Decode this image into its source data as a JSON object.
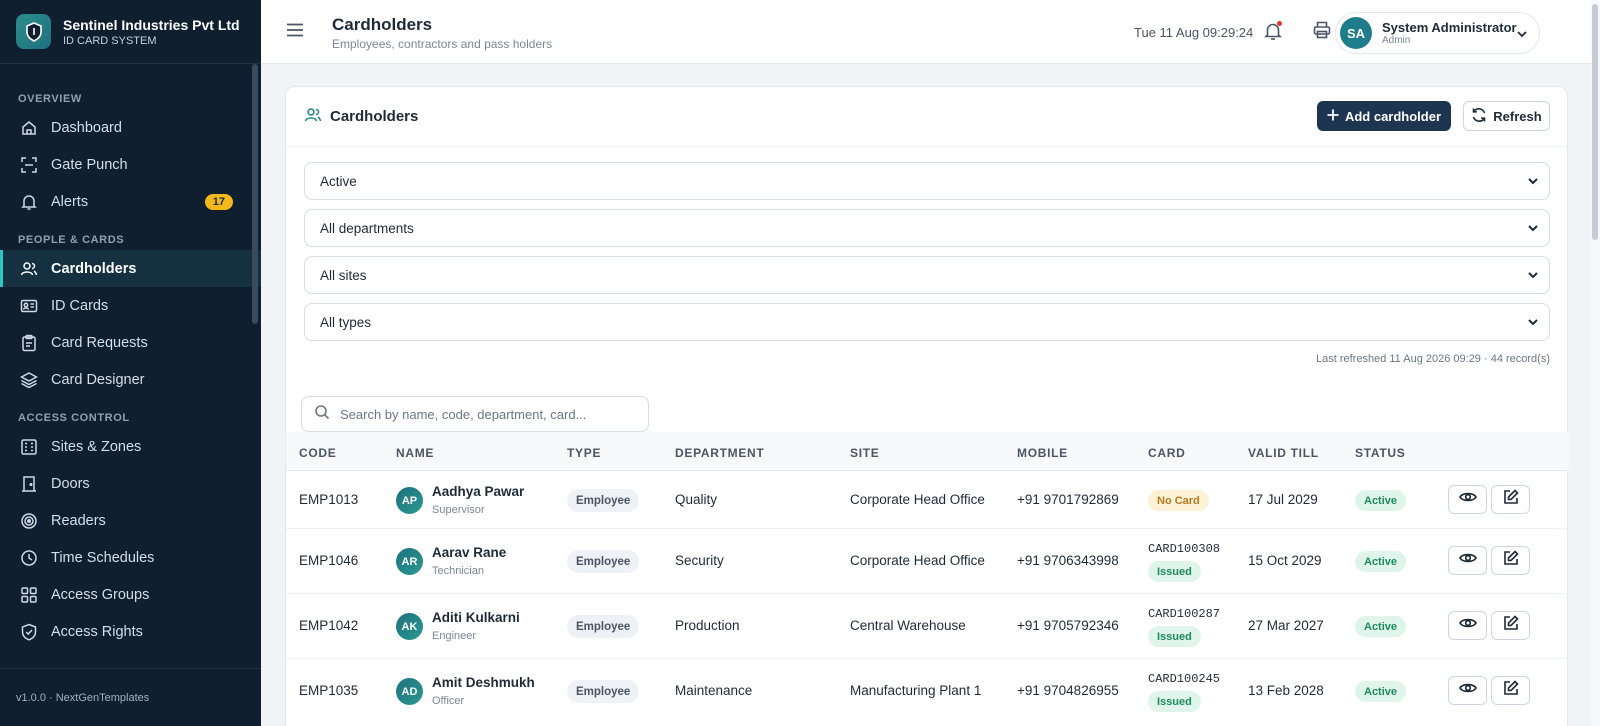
{
  "brand": {
    "name": "Sentinel Industries Pvt Ltd",
    "subtitle": "ID CARD SYSTEM"
  },
  "sidebar": {
    "sections": [
      {
        "title": "OVERVIEW",
        "items": [
          {
            "label": "Dashboard",
            "icon": "home-icon"
          },
          {
            "label": "Gate Punch",
            "icon": "scan-icon"
          },
          {
            "label": "Alerts",
            "icon": "bell-icon",
            "badge": "17"
          }
        ]
      },
      {
        "title": "PEOPLE & CARDS",
        "items": [
          {
            "label": "Cardholders",
            "icon": "users-icon",
            "active": true
          },
          {
            "label": "ID Cards",
            "icon": "id-card-icon"
          },
          {
            "label": "Card Requests",
            "icon": "clipboard-icon"
          },
          {
            "label": "Card Designer",
            "icon": "layers-icon"
          }
        ]
      },
      {
        "title": "ACCESS CONTROL",
        "items": [
          {
            "label": "Sites & Zones",
            "icon": "building-icon"
          },
          {
            "label": "Doors",
            "icon": "door-icon"
          },
          {
            "label": "Readers",
            "icon": "reader-icon"
          },
          {
            "label": "Time Schedules",
            "icon": "clock-icon"
          },
          {
            "label": "Access Groups",
            "icon": "grid-icon"
          },
          {
            "label": "Access Rights",
            "icon": "shield-icon"
          }
        ]
      }
    ],
    "footer": "v1.0.0 · NextGenTemplates"
  },
  "header": {
    "title": "Cardholders",
    "subtitle": "Employees, contractors and pass holders",
    "datetime": "Tue 11 Aug 09:29:24",
    "user": {
      "initials": "SA",
      "name": "System Administrator",
      "role": "Admin"
    }
  },
  "panel": {
    "title": "Cardholders",
    "add_label": "Add cardholder",
    "refresh_label": "Refresh",
    "filters": [
      "Active",
      "All departments",
      "All sites",
      "All types"
    ],
    "last_refreshed": "Last refreshed 11 Aug 2026 09:29 · 44 record(s)",
    "search_placeholder": "Search by name, code, department, card..."
  },
  "table": {
    "columns": [
      "CODE",
      "NAME",
      "TYPE",
      "DEPARTMENT",
      "SITE",
      "MOBILE",
      "CARD",
      "VALID TILL",
      "STATUS"
    ],
    "rows": [
      {
        "code": "EMP1013",
        "initials": "AP",
        "name": "Aadhya Pawar",
        "role": "Supervisor",
        "type": "Employee",
        "department": "Quality",
        "site": "Corporate Head Office",
        "mobile": "+91 9701792869",
        "card_no": "",
        "card_status": "No Card",
        "valid_till": "17 Jul 2029",
        "status": "Active"
      },
      {
        "code": "EMP1046",
        "initials": "AR",
        "name": "Aarav Rane",
        "role": "Technician",
        "type": "Employee",
        "department": "Security",
        "site": "Corporate Head Office",
        "mobile": "+91 9706343998",
        "card_no": "CARD100308",
        "card_status": "Issued",
        "valid_till": "15 Oct 2029",
        "status": "Active"
      },
      {
        "code": "EMP1042",
        "initials": "AK",
        "name": "Aditi Kulkarni",
        "role": "Engineer",
        "type": "Employee",
        "department": "Production",
        "site": "Central Warehouse",
        "mobile": "+91 9705792346",
        "card_no": "CARD100287",
        "card_status": "Issued",
        "valid_till": "27 Mar 2027",
        "status": "Active"
      },
      {
        "code": "EMP1035",
        "initials": "AD",
        "name": "Amit Deshmukh",
        "role": "Officer",
        "type": "Employee",
        "department": "Maintenance",
        "site": "Manufacturing Plant 1",
        "mobile": "+91 9704826955",
        "card_no": "CARD100245",
        "card_status": "Issued",
        "valid_till": "13 Feb 2028",
        "status": "Active"
      }
    ]
  },
  "colors": {
    "sidebar_bg": "#0f1f30",
    "accent": "#2dc5c0",
    "primary_button": "#1d3550",
    "active_badge": "#dff5ec",
    "alert_badge": "#f5b81b"
  }
}
